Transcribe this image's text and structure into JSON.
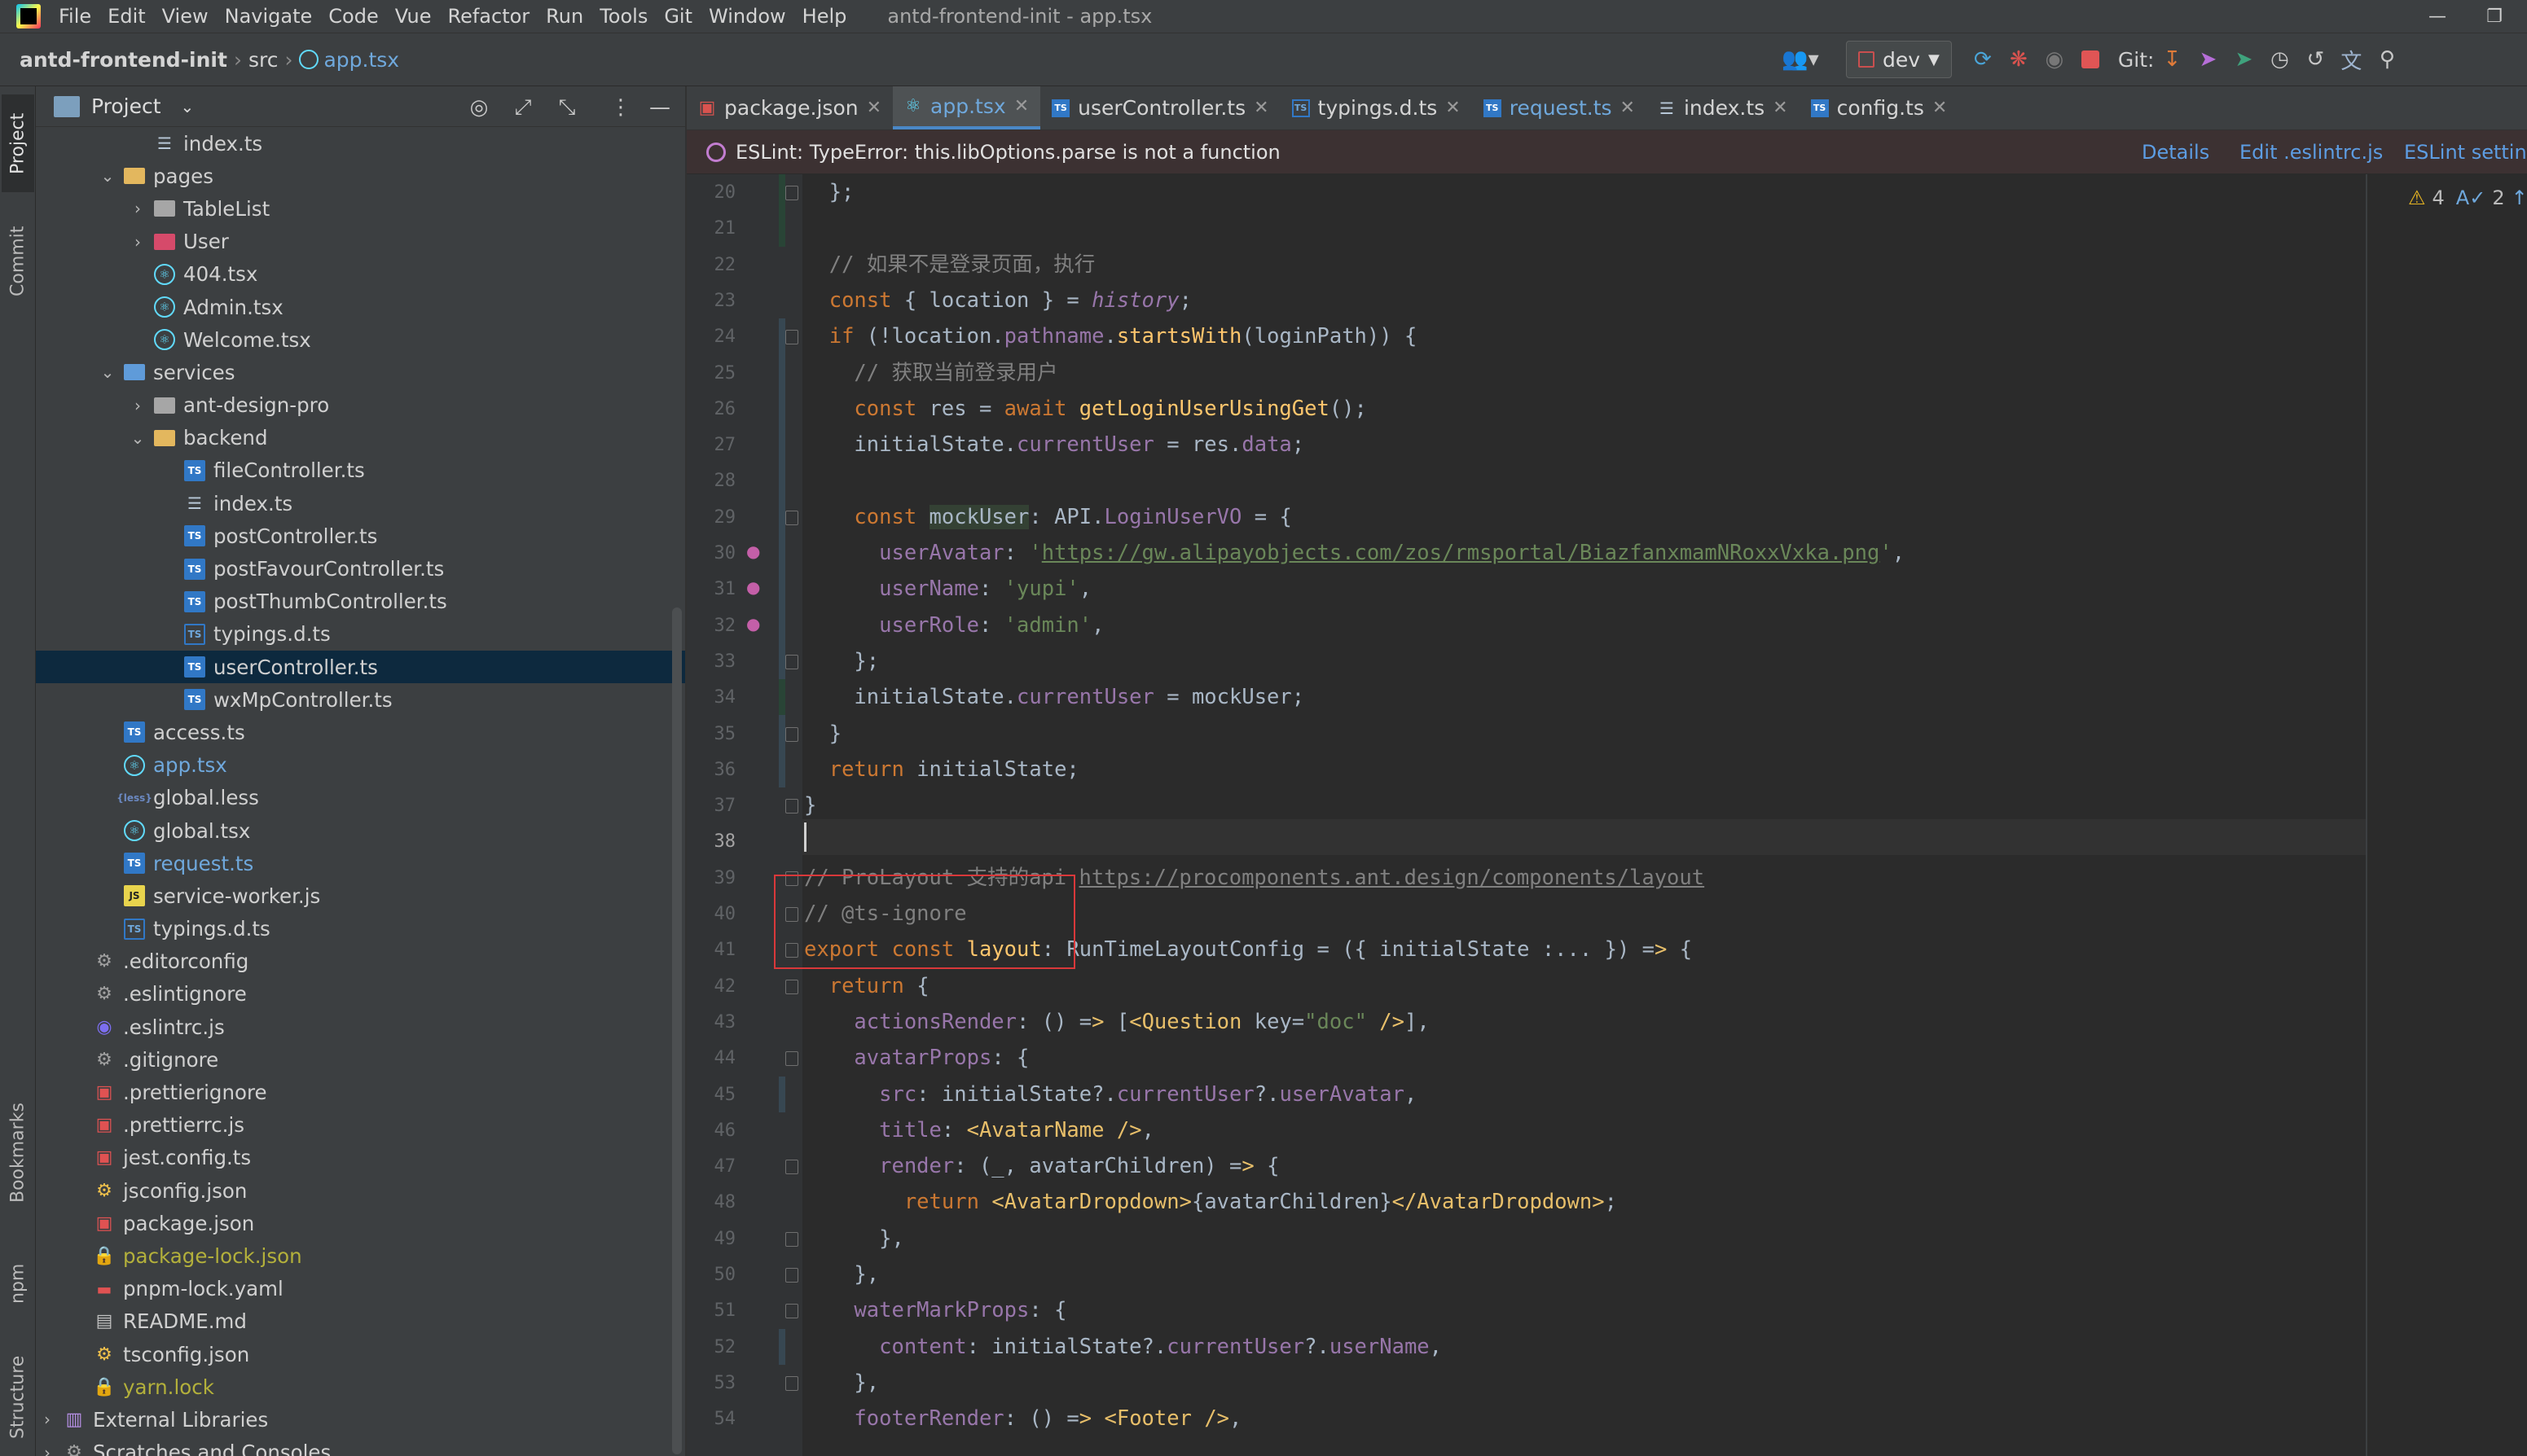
{
  "menubar": {
    "items": [
      "File",
      "Edit",
      "View",
      "Navigate",
      "Code",
      "Vue",
      "Refactor",
      "Run",
      "Tools",
      "Git",
      "Window",
      "Help"
    ],
    "title": "antd-frontend-init - app.tsx"
  },
  "navbar": {
    "project": "antd-frontend-init",
    "crumb_dir": "src",
    "crumb_file": "app.tsx",
    "branch": "dev",
    "git_label": "Git:"
  },
  "stripe": {
    "project": "Project",
    "commit": "Commit",
    "bookmarks": "Bookmarks",
    "npm": "npm",
    "structure": "Structure"
  },
  "project_panel": {
    "title": "Project",
    "rows": [
      {
        "label": "index.ts",
        "icon": "index",
        "indent": 3,
        "arrow": ""
      },
      {
        "label": "pages",
        "icon": "folder",
        "indent": 2,
        "arrow": "v"
      },
      {
        "label": "TableList",
        "icon": "folder-gray",
        "indent": 3,
        "arrow": ">"
      },
      {
        "label": "User",
        "icon": "folder-red",
        "indent": 3,
        "arrow": ">"
      },
      {
        "label": "404.tsx",
        "icon": "react",
        "indent": 3,
        "arrow": ""
      },
      {
        "label": "Admin.tsx",
        "icon": "react",
        "indent": 3,
        "arrow": ""
      },
      {
        "label": "Welcome.tsx",
        "icon": "react",
        "indent": 3,
        "arrow": ""
      },
      {
        "label": "services",
        "icon": "folder-blue",
        "indent": 2,
        "arrow": "v"
      },
      {
        "label": "ant-design-pro",
        "icon": "folder-gray",
        "indent": 3,
        "arrow": ">"
      },
      {
        "label": "backend",
        "icon": "folder",
        "indent": 3,
        "arrow": "v"
      },
      {
        "label": "fileController.ts",
        "icon": "ts",
        "indent": 4,
        "arrow": ""
      },
      {
        "label": "index.ts",
        "icon": "index",
        "indent": 4,
        "arrow": ""
      },
      {
        "label": "postController.ts",
        "icon": "ts",
        "indent": 4,
        "arrow": ""
      },
      {
        "label": "postFavourController.ts",
        "icon": "ts",
        "indent": 4,
        "arrow": ""
      },
      {
        "label": "postThumbController.ts",
        "icon": "ts",
        "indent": 4,
        "arrow": ""
      },
      {
        "label": "typings.d.ts",
        "icon": "ts-d",
        "indent": 4,
        "arrow": ""
      },
      {
        "label": "userController.ts",
        "icon": "ts",
        "indent": 4,
        "arrow": "",
        "selected": true
      },
      {
        "label": "wxMpController.ts",
        "icon": "ts",
        "indent": 4,
        "arrow": ""
      },
      {
        "label": "access.ts",
        "icon": "ts",
        "indent": 2,
        "arrow": ""
      },
      {
        "label": "app.tsx",
        "icon": "react",
        "indent": 2,
        "arrow": "",
        "color": "blue"
      },
      {
        "label": "global.less",
        "icon": "less",
        "indent": 2,
        "arrow": ""
      },
      {
        "label": "global.tsx",
        "icon": "react",
        "indent": 2,
        "arrow": ""
      },
      {
        "label": "request.ts",
        "icon": "ts",
        "indent": 2,
        "arrow": "",
        "color": "blue"
      },
      {
        "label": "service-worker.js",
        "icon": "js",
        "indent": 2,
        "arrow": ""
      },
      {
        "label": "typings.d.ts",
        "icon": "ts-d",
        "indent": 2,
        "arrow": ""
      },
      {
        "label": ".editorconfig",
        "icon": "gear",
        "indent": 1,
        "arrow": ""
      },
      {
        "label": ".eslintignore",
        "icon": "gear",
        "indent": 1,
        "arrow": ""
      },
      {
        "label": ".eslintrc.js",
        "icon": "purple",
        "indent": 1,
        "arrow": ""
      },
      {
        "label": ".gitignore",
        "icon": "gear",
        "indent": 1,
        "arrow": ""
      },
      {
        "label": ".prettierignore",
        "icon": "red",
        "indent": 1,
        "arrow": ""
      },
      {
        "label": ".prettierrc.js",
        "icon": "red",
        "indent": 1,
        "arrow": ""
      },
      {
        "label": "jest.config.ts",
        "icon": "red",
        "indent": 1,
        "arrow": ""
      },
      {
        "label": "jsconfig.json",
        "icon": "json",
        "indent": 1,
        "arrow": ""
      },
      {
        "label": "package.json",
        "icon": "red",
        "indent": 1,
        "arrow": ""
      },
      {
        "label": "package-lock.json",
        "icon": "lock",
        "indent": 1,
        "arrow": "",
        "color": "olive"
      },
      {
        "label": "pnpm-lock.yaml",
        "icon": "yaml",
        "indent": 1,
        "arrow": ""
      },
      {
        "label": "README.md",
        "icon": "md",
        "indent": 1,
        "arrow": ""
      },
      {
        "label": "tsconfig.json",
        "icon": "json",
        "indent": 1,
        "arrow": ""
      },
      {
        "label": "yarn.lock",
        "icon": "lock",
        "indent": 1,
        "arrow": "",
        "color": "olive"
      },
      {
        "label": "External Libraries",
        "icon": "lib",
        "indent": 0,
        "arrow": ">"
      },
      {
        "label": "Scratches and Consoles",
        "icon": "gear",
        "indent": 0,
        "arrow": ">"
      }
    ]
  },
  "tabs": [
    {
      "label": "package.json",
      "icon": "json-red"
    },
    {
      "label": "app.tsx",
      "icon": "react",
      "active": true
    },
    {
      "label": "userController.ts",
      "icon": "ts"
    },
    {
      "label": "typings.d.ts",
      "icon": "ts-d"
    },
    {
      "label": "request.ts",
      "icon": "ts",
      "color": "blue"
    },
    {
      "label": "index.ts",
      "icon": "index"
    },
    {
      "label": "config.ts",
      "icon": "ts"
    }
  ],
  "eslint": {
    "message": "ESLint: TypeError: this.libOptions.parse is not a function",
    "details": "Details",
    "edit": "Edit .eslintrc.js",
    "settings": "ESLint settings"
  },
  "inspections": {
    "warnings": "4",
    "typos": "2"
  },
  "editor": {
    "first_line": 20,
    "current_line": 38,
    "lines": [
      "  };",
      "",
      "  // 如果不是登录页面，执行",
      "  const { location } = history;",
      "  if (!location.pathname.startsWith(loginPath)) {",
      "    // 获取当前登录用户",
      "    const res = await getLoginUserUsingGet();",
      "    initialState.currentUser = res.data;",
      "",
      "    const mockUser: API.LoginUserVO = {",
      "      userAvatar: 'https://gw.alipayobjects.com/zos/rmsportal/BiazfanxmamNRoxxVxka.png',",
      "      userName: 'yupi',",
      "      userRole: 'admin',",
      "    };",
      "    initialState.currentUser = mockUser;",
      "  }",
      "  return initialState;",
      "}",
      "",
      "// ProLayout 支持的api https://procomponents.ant.design/components/layout",
      "// @ts-ignore",
      "export const layout: RunTimeLayoutConfig = ({ initialState :... }) => {",
      "  return {",
      "    actionsRender: () => [<Question key=\"doc\" />],",
      "    avatarProps: {",
      "      src: initialState?.currentUser?.userAvatar,",
      "      title: <AvatarName />,",
      "      render: (_, avatarChildren) => {",
      "        return <AvatarDropdown>{avatarChildren}</AvatarDropdown>;",
      "      },",
      "    },",
      "    waterMarkProps: {",
      "      content: initialState?.currentUser?.userName,",
      "    },",
      "    footerRender: () => <Footer />,"
    ]
  },
  "colors": {
    "accent": "#4a88c7",
    "keyword": "#cc7832",
    "string": "#6a8759",
    "comment": "#808080",
    "property": "#9876aa",
    "function": "#ffc66d",
    "tag": "#e8bf6a",
    "highlight_box": "#d9383a"
  }
}
